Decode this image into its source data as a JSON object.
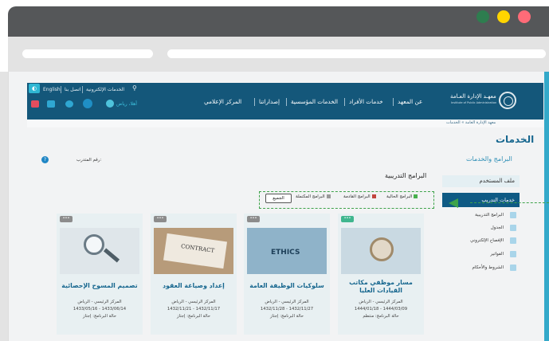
{
  "colors": {
    "header_bg": "#14577a",
    "accent": "#17678f",
    "active_menu": "#0f5a84",
    "highlight_dashed": "#3ea34a",
    "dot_green": "#2e7d4f",
    "dot_yellow": "#ffd500",
    "dot_red": "#ff6b78"
  },
  "header": {
    "lang": "English",
    "eservices": "الخدمات الإلكترونية",
    "contact": "اتصل بنا",
    "welcome": "أهلا، رياض",
    "nav": [
      "عن المعهد",
      "خدمات الأفراد",
      "الخدمات المؤسسية",
      "إصداراتنا",
      "المركز الإعلامي"
    ],
    "logo_ar": "معهـد الإدارة العـامة",
    "logo_en": "Institute of Public Administration"
  },
  "breadcrumb": "معهد الإدارة العامة » الخدمات",
  "page_title": "الخدمات",
  "section_title": "البرامج والخدمات",
  "trainee_number_label": "رقم المتدرب:",
  "sidebar": {
    "header": "ملف المستخدم",
    "active": "خدمات التدريب",
    "items": [
      "البرامج التدريبية",
      "الجدول",
      "الإفصاح الإلكتروني",
      "الفواتير",
      "الشروط والأحكام"
    ]
  },
  "programs": {
    "title": "البرامج التدريبية",
    "filters": [
      "البرامج الحالية",
      "البرامج القادمة",
      "البرامج المكتملة"
    ],
    "all_label": "الجميع"
  },
  "cards": [
    {
      "title": "مسار موظفي مكاتب القيادات العليا",
      "location": "المركز الرئيسي - الرياض",
      "dates": "1444/01/18 - 1444/03/09",
      "status": "حالة البرنامج: منتظم",
      "badge": "•••"
    },
    {
      "title": "سلوكيات الوظيفة العامة",
      "location": "المركز الرئيسي - الرياض",
      "dates": "1432/11/28 - 1432/11/27",
      "status": "حالة البرنامج: إجتاز",
      "badge": "•••",
      "img_word": "ETHICS"
    },
    {
      "title": "إعداد وصياغة العقود",
      "location": "المركز الرئيسي - الرياض",
      "dates": "1432/11/21 - 1432/11/17",
      "status": "حالة البرنامج: إجتاز",
      "badge": "•••",
      "img_word": "CONTRACT"
    },
    {
      "title": "تصميم المسوح الإحصائية",
      "location": "المركز الرئيسي - الرياض",
      "dates": "1433/05/16 - 1433/06/14",
      "status": "حالة البرنامج: إجتاز",
      "badge": "•••"
    }
  ]
}
